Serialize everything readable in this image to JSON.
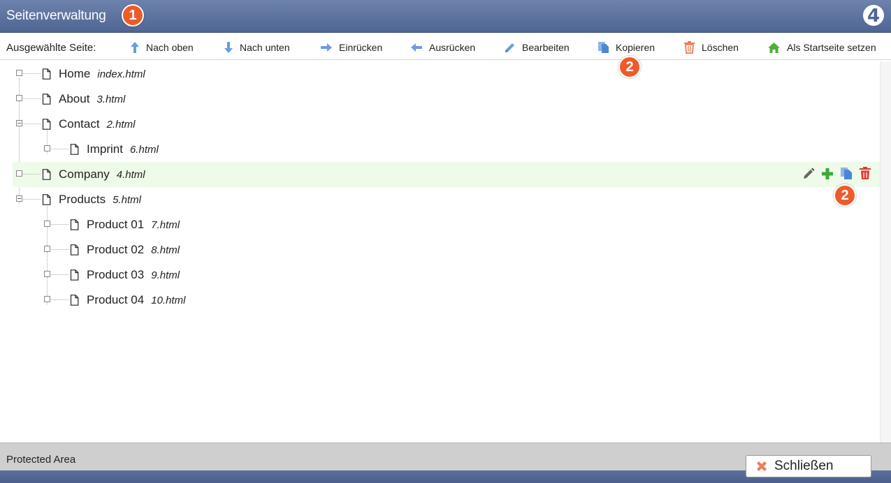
{
  "window": {
    "title": "Seitenverwaltung",
    "logo_text": "4"
  },
  "badges": {
    "title_badge": "1",
    "toolbar_badge": "2",
    "row_badge": "2"
  },
  "toolbar": {
    "label": "Ausgewählte Seite:",
    "buttons": [
      {
        "label": "Nach oben",
        "icon": "arrow-up-icon"
      },
      {
        "label": "Nach unten",
        "icon": "arrow-down-icon"
      },
      {
        "label": "Einrücken",
        "icon": "arrow-right-icon"
      },
      {
        "label": "Ausrücken",
        "icon": "arrow-left-icon"
      },
      {
        "label": "Bearbeiten",
        "icon": "pencil-icon"
      },
      {
        "label": "Kopieren",
        "icon": "copy-icon"
      },
      {
        "label": "Löschen",
        "icon": "trash-icon"
      },
      {
        "label": "Als Startseite setzen",
        "icon": "home-icon"
      }
    ]
  },
  "tree": {
    "nodes": [
      {
        "name": "Home",
        "file": "index.html",
        "level": 0,
        "expanded": false
      },
      {
        "name": "About",
        "file": "3.html",
        "level": 0,
        "expanded": false
      },
      {
        "name": "Contact",
        "file": "2.html",
        "level": 0,
        "expanded": true
      },
      {
        "name": "Imprint",
        "file": "6.html",
        "level": 1,
        "expanded": false
      },
      {
        "name": "Company",
        "file": "4.html",
        "level": 0,
        "expanded": false,
        "selected": true
      },
      {
        "name": "Products",
        "file": "5.html",
        "level": 0,
        "expanded": true
      },
      {
        "name": "Product 01",
        "file": "7.html",
        "level": 1,
        "expanded": false
      },
      {
        "name": "Product 02",
        "file": "8.html",
        "level": 1,
        "expanded": false
      },
      {
        "name": "Product 03",
        "file": "9.html",
        "level": 1,
        "expanded": false
      },
      {
        "name": "Product 04",
        "file": "10.html",
        "level": 1,
        "expanded": false
      }
    ],
    "row_actions": [
      "pencil-icon",
      "plus-icon",
      "copy-icon",
      "trash-icon"
    ]
  },
  "footer": {
    "text": "Protected Area"
  },
  "close_button": {
    "label": "Schließen",
    "icon": "close-x-icon"
  },
  "colors": {
    "accent": "#5a6f9b",
    "badge": "#ee5b2b",
    "selected_row": "#eefbe9",
    "green": "#3aaa35",
    "red": "#e53935",
    "icon_blue": "#6b9be0"
  }
}
